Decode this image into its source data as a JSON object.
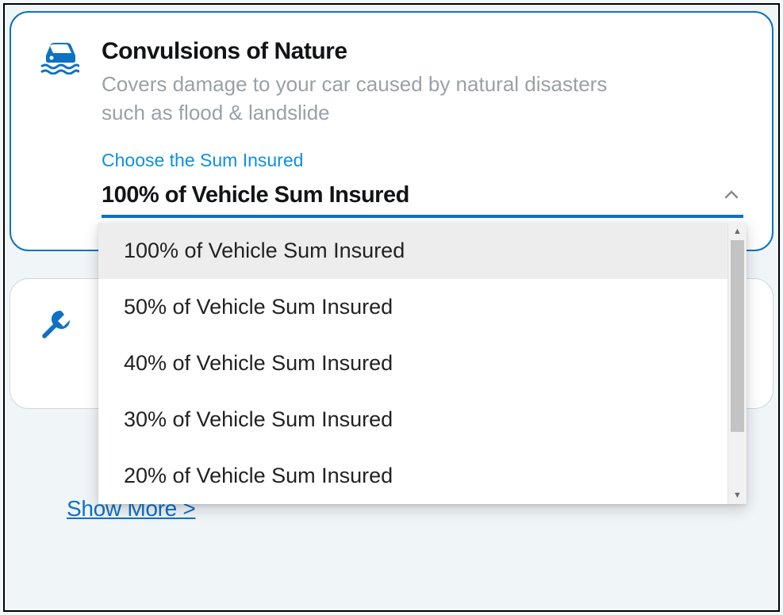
{
  "coverage": {
    "title": "Convulsions of Nature",
    "description": "Covers damage to your car caused by natural disasters such as flood & landslide",
    "field_label": "Choose the Sum Insured",
    "selected_value": "100% of Vehicle Sum Insured",
    "options": [
      "100% of Vehicle Sum Insured",
      "50% of Vehicle Sum Insured",
      "40% of Vehicle Sum Insured",
      "30% of Vehicle Sum Insured",
      "20% of Vehicle Sum Insured"
    ]
  },
  "show_more_label": "Show More >",
  "colors": {
    "primary": "#0d72c4",
    "link": "#0d90df",
    "text": "#121315",
    "muted": "#9aa1a6"
  }
}
